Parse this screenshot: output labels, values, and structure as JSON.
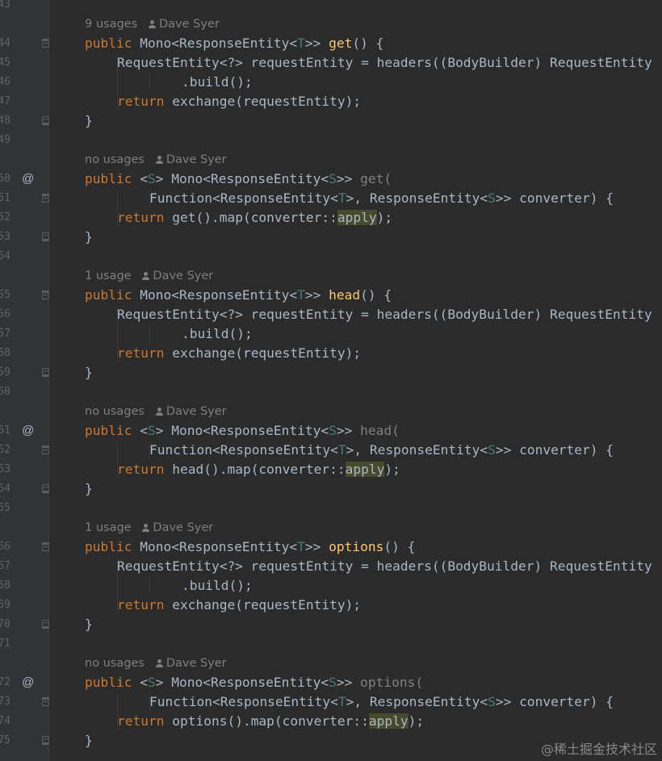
{
  "editor": {
    "watermark": "@稀土掘金技术社区",
    "colors": {
      "background": "#2b2b2b",
      "gutter": "#313335",
      "keyword": "#cc7832",
      "function": "#ffc66d",
      "type_param": "#507874",
      "text": "#a9b7c6",
      "line_number": "#606366",
      "hint": "#7c7f83",
      "highlight": "#484a2c"
    },
    "lines": [
      {
        "n": "43",
        "kind": "blank"
      },
      {
        "n": "",
        "kind": "hint",
        "usages": "9 usages",
        "author": "Dave Syer"
      },
      {
        "n": "44",
        "kind": "code",
        "indent": 0,
        "fold": "open",
        "tokens": [
          {
            "t": "public ",
            "c": "k"
          },
          {
            "t": "Mono<ResponseEntity<"
          },
          {
            "t": "T",
            "c": "tp"
          },
          {
            "t": ">> "
          },
          {
            "t": "get",
            "c": "fn"
          },
          {
            "t": "() {"
          }
        ]
      },
      {
        "n": "45",
        "kind": "code",
        "indent": 1,
        "tokens": [
          {
            "t": "RequestEntity<?> requestEntity = headers((BodyBuilder) RequestEntity"
          }
        ]
      },
      {
        "n": "46",
        "kind": "code",
        "indent": 3,
        "tokens": [
          {
            "t": ".build();"
          }
        ]
      },
      {
        "n": "47",
        "kind": "code",
        "indent": 1,
        "tokens": [
          {
            "t": "return ",
            "c": "k"
          },
          {
            "t": "exchange(requestEntity);"
          }
        ]
      },
      {
        "n": "48",
        "kind": "code",
        "indent": 0,
        "fold": "close",
        "tokens": [
          {
            "t": "}"
          }
        ]
      },
      {
        "n": "49",
        "kind": "blank"
      },
      {
        "n": "",
        "kind": "hint",
        "usages": "no usages",
        "author": "Dave Syer"
      },
      {
        "n": "50",
        "kind": "code",
        "indent": 0,
        "marker": "@",
        "tokens": [
          {
            "t": "public ",
            "c": "k"
          },
          {
            "t": "<"
          },
          {
            "t": "S",
            "c": "tp"
          },
          {
            "t": "> Mono<ResponseEntity<"
          },
          {
            "t": "S",
            "c": "tp"
          },
          {
            "t": ">> "
          },
          {
            "t": "get(",
            "c": "dim"
          }
        ]
      },
      {
        "n": "51",
        "kind": "code",
        "indent": 2,
        "fold": "open",
        "tokens": [
          {
            "t": "Function<ResponseEntity<"
          },
          {
            "t": "T",
            "c": "tp"
          },
          {
            "t": ">, ResponseEntity<"
          },
          {
            "t": "S",
            "c": "tp"
          },
          {
            "t": ">> converter) {"
          }
        ]
      },
      {
        "n": "52",
        "kind": "code",
        "indent": 1,
        "tokens": [
          {
            "t": "return ",
            "c": "k"
          },
          {
            "t": "get().map(converter::"
          },
          {
            "t": "apply",
            "c": "hl"
          },
          {
            "t": ");"
          }
        ]
      },
      {
        "n": "53",
        "kind": "code",
        "indent": 0,
        "fold": "close",
        "tokens": [
          {
            "t": "}"
          }
        ]
      },
      {
        "n": "54",
        "kind": "blank"
      },
      {
        "n": "",
        "kind": "hint",
        "usages": "1 usage",
        "author": "Dave Syer"
      },
      {
        "n": "55",
        "kind": "code",
        "indent": 0,
        "fold": "open",
        "tokens": [
          {
            "t": "public ",
            "c": "k"
          },
          {
            "t": "Mono<ResponseEntity<"
          },
          {
            "t": "T",
            "c": "tp"
          },
          {
            "t": ">> "
          },
          {
            "t": "head",
            "c": "fn"
          },
          {
            "t": "() {"
          }
        ]
      },
      {
        "n": "56",
        "kind": "code",
        "indent": 1,
        "tokens": [
          {
            "t": "RequestEntity<?> requestEntity = headers((BodyBuilder) RequestEntity"
          }
        ]
      },
      {
        "n": "57",
        "kind": "code",
        "indent": 3,
        "tokens": [
          {
            "t": ".build();"
          }
        ]
      },
      {
        "n": "58",
        "kind": "code",
        "indent": 1,
        "tokens": [
          {
            "t": "return ",
            "c": "k"
          },
          {
            "t": "exchange(requestEntity);"
          }
        ]
      },
      {
        "n": "59",
        "kind": "code",
        "indent": 0,
        "fold": "close",
        "tokens": [
          {
            "t": "}"
          }
        ]
      },
      {
        "n": "60",
        "kind": "blank"
      },
      {
        "n": "",
        "kind": "hint",
        "usages": "no usages",
        "author": "Dave Syer"
      },
      {
        "n": "61",
        "kind": "code",
        "indent": 0,
        "marker": "@",
        "tokens": [
          {
            "t": "public ",
            "c": "k"
          },
          {
            "t": "<"
          },
          {
            "t": "S",
            "c": "tp"
          },
          {
            "t": "> Mono<ResponseEntity<"
          },
          {
            "t": "S",
            "c": "tp"
          },
          {
            "t": ">> "
          },
          {
            "t": "head(",
            "c": "dim"
          }
        ]
      },
      {
        "n": "62",
        "kind": "code",
        "indent": 2,
        "fold": "open",
        "tokens": [
          {
            "t": "Function<ResponseEntity<"
          },
          {
            "t": "T",
            "c": "tp"
          },
          {
            "t": ">, ResponseEntity<"
          },
          {
            "t": "S",
            "c": "tp"
          },
          {
            "t": ">> converter) {"
          }
        ]
      },
      {
        "n": "63",
        "kind": "code",
        "indent": 1,
        "tokens": [
          {
            "t": "return ",
            "c": "k"
          },
          {
            "t": "head().map(converter::"
          },
          {
            "t": "apply",
            "c": "hl"
          },
          {
            "t": ");"
          }
        ]
      },
      {
        "n": "64",
        "kind": "code",
        "indent": 0,
        "fold": "close",
        "tokens": [
          {
            "t": "}"
          }
        ]
      },
      {
        "n": "65",
        "kind": "blank"
      },
      {
        "n": "",
        "kind": "hint",
        "usages": "1 usage",
        "author": "Dave Syer"
      },
      {
        "n": "66",
        "kind": "code",
        "indent": 0,
        "fold": "open",
        "tokens": [
          {
            "t": "public ",
            "c": "k"
          },
          {
            "t": "Mono<ResponseEntity<"
          },
          {
            "t": "T",
            "c": "tp"
          },
          {
            "t": ">> "
          },
          {
            "t": "options",
            "c": "fn"
          },
          {
            "t": "() {"
          }
        ]
      },
      {
        "n": "67",
        "kind": "code",
        "indent": 1,
        "tokens": [
          {
            "t": "RequestEntity<?> requestEntity = headers((BodyBuilder) RequestEntity"
          }
        ]
      },
      {
        "n": "68",
        "kind": "code",
        "indent": 3,
        "tokens": [
          {
            "t": ".build();"
          }
        ]
      },
      {
        "n": "69",
        "kind": "code",
        "indent": 1,
        "tokens": [
          {
            "t": "return ",
            "c": "k"
          },
          {
            "t": "exchange(requestEntity);"
          }
        ]
      },
      {
        "n": "70",
        "kind": "code",
        "indent": 0,
        "fold": "close",
        "tokens": [
          {
            "t": "}"
          }
        ]
      },
      {
        "n": "71",
        "kind": "blank"
      },
      {
        "n": "",
        "kind": "hint",
        "usages": "no usages",
        "author": "Dave Syer"
      },
      {
        "n": "72",
        "kind": "code",
        "indent": 0,
        "marker": "@",
        "tokens": [
          {
            "t": "public ",
            "c": "k"
          },
          {
            "t": "<"
          },
          {
            "t": "S",
            "c": "tp"
          },
          {
            "t": "> Mono<ResponseEntity<"
          },
          {
            "t": "S",
            "c": "tp"
          },
          {
            "t": ">> "
          },
          {
            "t": "options(",
            "c": "dim"
          }
        ]
      },
      {
        "n": "73",
        "kind": "code",
        "indent": 2,
        "fold": "open",
        "tokens": [
          {
            "t": "Function<ResponseEntity<"
          },
          {
            "t": "T",
            "c": "tp"
          },
          {
            "t": ">, ResponseEntity<"
          },
          {
            "t": "S",
            "c": "tp"
          },
          {
            "t": ">> converter) {"
          }
        ]
      },
      {
        "n": "74",
        "kind": "code",
        "indent": 1,
        "tokens": [
          {
            "t": "return ",
            "c": "k"
          },
          {
            "t": "options().map(converter::"
          },
          {
            "t": "apply",
            "c": "hl"
          },
          {
            "t": ");"
          }
        ]
      },
      {
        "n": "75",
        "kind": "code",
        "indent": 0,
        "fold": "close",
        "tokens": [
          {
            "t": "}"
          }
        ]
      }
    ]
  }
}
